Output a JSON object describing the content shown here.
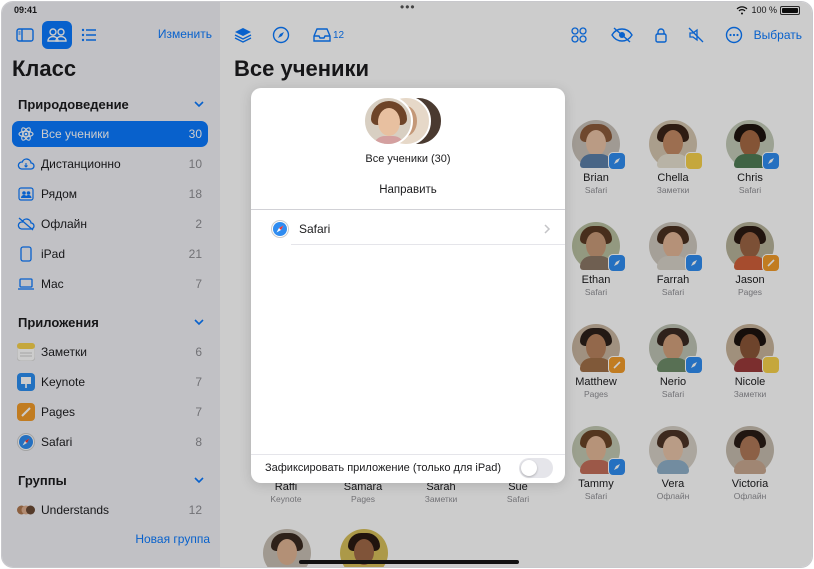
{
  "status": {
    "time": "09:41",
    "battery": "100 %"
  },
  "sidebar": {
    "edit_label": "Изменить",
    "title": "Класс",
    "sections": {
      "nature": "Природоведение",
      "apps": "Приложения",
      "groups": "Группы"
    },
    "items": [
      {
        "label": "Все ученики",
        "count": "30",
        "icon": "atom-icon"
      },
      {
        "label": "Дистанционно",
        "count": "10",
        "icon": "cloud-icon"
      },
      {
        "label": "Рядом",
        "count": "18",
        "icon": "people-icon"
      },
      {
        "label": "Офлайн",
        "count": "2",
        "icon": "cloud-offline-icon"
      },
      {
        "label": "iPad",
        "count": "21",
        "icon": "ipad-icon"
      },
      {
        "label": "Mac",
        "count": "7",
        "icon": "laptop-icon"
      }
    ],
    "apps": [
      {
        "label": "Заметки",
        "count": "6",
        "icon": "notes-icon"
      },
      {
        "label": "Keynote",
        "count": "7",
        "icon": "keynote-icon"
      },
      {
        "label": "Pages",
        "count": "7",
        "icon": "pages-icon"
      },
      {
        "label": "Safari",
        "count": "8",
        "icon": "safari-icon"
      }
    ],
    "groups": [
      {
        "label": "Understands",
        "count": "12",
        "icon": "group-avatars-icon"
      }
    ],
    "new_group": "Новая группа"
  },
  "toolbar": {
    "inbox_count": "12",
    "choose_label": "Выбрать"
  },
  "main": {
    "title": "Все ученики"
  },
  "students": [
    {
      "name": "Brian",
      "app": "Safari"
    },
    {
      "name": "Chella",
      "app": "Заметки"
    },
    {
      "name": "Chris",
      "app": "Safari"
    },
    {
      "name": "Ethan",
      "app": "Safari"
    },
    {
      "name": "Farrah",
      "app": "Safari"
    },
    {
      "name": "Jason",
      "app": "Pages"
    },
    {
      "name": "Matthew",
      "app": "Pages"
    },
    {
      "name": "Nerio",
      "app": "Safari"
    },
    {
      "name": "Nicole",
      "app": "Заметки"
    },
    {
      "name": "Tammy",
      "app": "Safari"
    },
    {
      "name": "Vera",
      "app": "Офлайн"
    },
    {
      "name": "Victoria",
      "app": "Офлайн"
    },
    {
      "name": "Raffi",
      "app": "Keynote"
    },
    {
      "name": "Samara",
      "app": "Pages"
    },
    {
      "name": "Sarah",
      "app": "Заметки"
    },
    {
      "name": "Sue",
      "app": "Safari"
    }
  ],
  "sheet": {
    "subtitle": "Все ученики (30)",
    "title": "Направить",
    "app_label": "Safari",
    "lock_label": "Зафиксировать приложение (только для iPad)"
  },
  "colors": {
    "accent": "#0a7aff",
    "safari": "#2f8cf0",
    "pages": "#f29b2a",
    "notes": "#f7d14c",
    "keynote": "#2b8ef0"
  }
}
